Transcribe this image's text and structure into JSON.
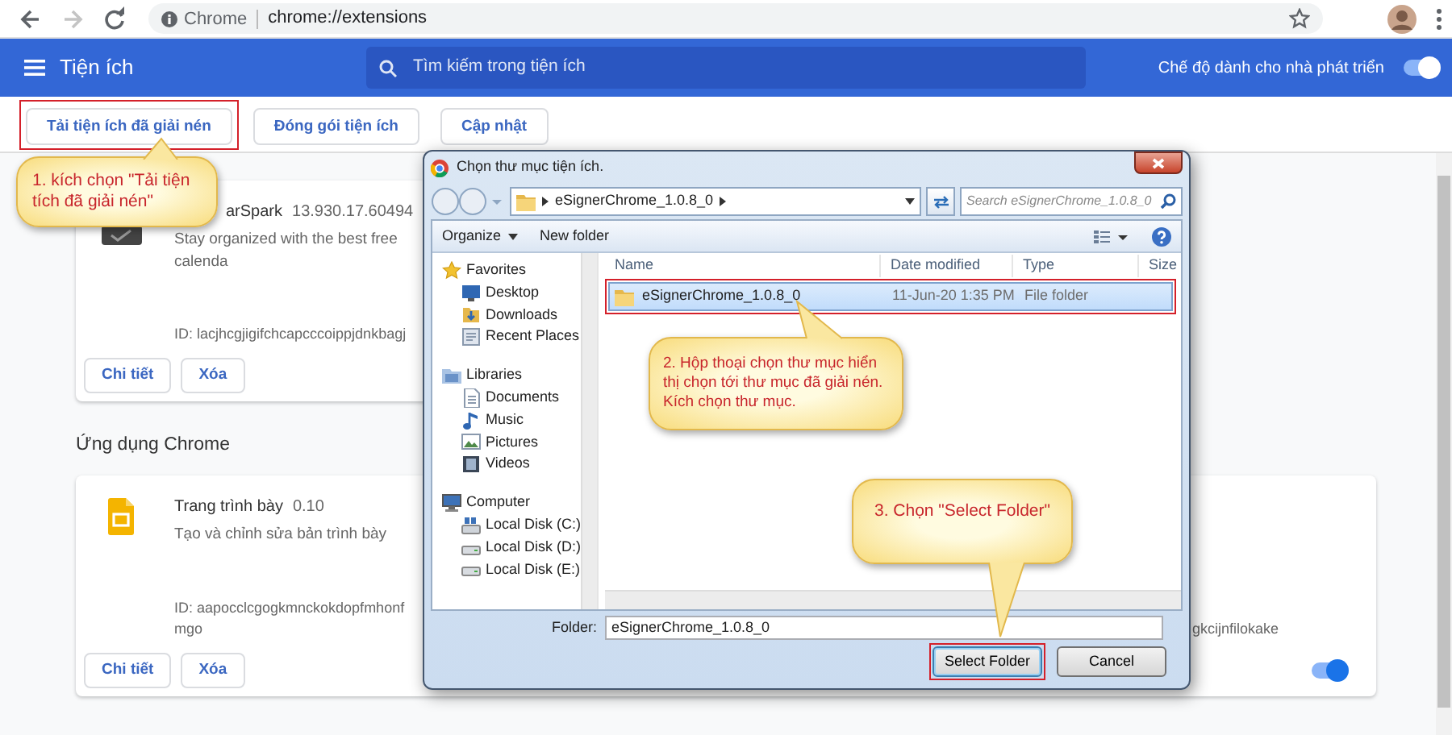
{
  "nav_buttons": [
    {
      "kind": "back",
      "disabled": false
    },
    {
      "kind": "forward",
      "disabled": true
    },
    {
      "kind": "reload",
      "disabled": false
    }
  ],
  "address_bar": {
    "site": "Chrome",
    "url": "chrome://extensions"
  },
  "header": {
    "title": "Tiện ích",
    "search_placeholder": "Tìm kiếm trong tiện ích",
    "dev_mode_label": "Chế độ dành cho nhà phát triển",
    "dev_mode_on": true
  },
  "toolbar_buttons": [
    {
      "label": "Tải tiện ích đã giải nén",
      "highlighted": true
    },
    {
      "label": "Đóng gói tiện ích",
      "highlighted": false
    },
    {
      "label": "Cập nhật",
      "highlighted": false
    }
  ],
  "extensions": [
    {
      "name": "arSpark",
      "version": "13.930.17.60494",
      "description": "Stay organized with the best free calenda",
      "id": "ID: lacjhcgjigifchcapcccoippjdnkbagj",
      "buttons": [
        "Chi tiết",
        "Xóa"
      ]
    }
  ],
  "apps_heading": "Ứng dụng Chrome",
  "apps": [
    {
      "name": "Trang trình bày",
      "version": "0.10",
      "description": "Tạo và chỉnh sửa bản trình bày",
      "id": "ID: aapocclcgogkmnckokdopfmhonfmgo",
      "id_tail": "gkcijnfilokake",
      "enabled": true,
      "buttons": [
        "Chi tiết",
        "Xóa"
      ]
    }
  ],
  "dialog": {
    "title": "Chọn thư mục tiện ích.",
    "breadcrumb": "eSignerChrome_1.0.8_0",
    "search_placeholder": "Search eSignerChrome_1.0.8_0",
    "toolbar": [
      {
        "label": "Organize",
        "dropdown": true
      },
      {
        "label": "New folder",
        "dropdown": false
      }
    ],
    "nav_tree": [
      {
        "label": "Favorites",
        "kind": "star",
        "children": [
          {
            "label": "Desktop",
            "kind": "desktop"
          },
          {
            "label": "Downloads",
            "kind": "downloads"
          },
          {
            "label": "Recent Places",
            "kind": "recent"
          }
        ]
      },
      {
        "label": "Libraries",
        "kind": "library",
        "children": [
          {
            "label": "Documents",
            "kind": "document"
          },
          {
            "label": "Music",
            "kind": "music"
          },
          {
            "label": "Pictures",
            "kind": "pictures"
          },
          {
            "label": "Videos",
            "kind": "videos"
          }
        ]
      },
      {
        "label": "Computer",
        "kind": "computer",
        "children": [
          {
            "label": "Local Disk (C:)",
            "kind": "system_disk"
          },
          {
            "label": "Local Disk (D:)",
            "kind": "disk"
          },
          {
            "label": "Local Disk (E:)",
            "kind": "disk"
          }
        ]
      }
    ],
    "columns": [
      "Name",
      "Date modified",
      "Type",
      "Size"
    ],
    "files": [
      {
        "name": "eSignerChrome_1.0.8_0",
        "date": "11-Jun-20 1:35 PM",
        "type": "File folder",
        "selected": true,
        "highlighted": true
      }
    ],
    "folder_label": "Folder:",
    "folder_value": "eSignerChrome_1.0.8_0",
    "buttons": [
      {
        "label": "Select Folder",
        "default": true,
        "highlighted": true
      },
      {
        "label": "Cancel",
        "default": false,
        "highlighted": false
      }
    ]
  },
  "callouts": [
    {
      "text": "1. kích chọn \"Tải tiện tích đã giải nén\""
    },
    {
      "text": "2. Hộp thoại chọn thư mục hiển thị chọn tới thư mục đã giải nén. Kích chọn thư mục."
    },
    {
      "text": "3. Chọn \"Select Folder\""
    }
  ]
}
